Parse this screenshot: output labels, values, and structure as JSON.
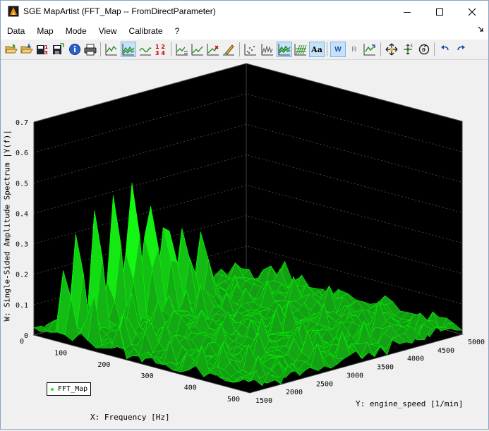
{
  "window": {
    "title": "SGE MapArtist (FFT_Map -- FromDirectParameter)",
    "controls": [
      "minimize",
      "maximize",
      "close"
    ]
  },
  "menu": {
    "items": [
      "Data",
      "Map",
      "Mode",
      "View",
      "Calibrate",
      "?"
    ],
    "overflow_icon": "chevron-down-right-icon"
  },
  "toolbar": {
    "buttons": [
      {
        "icon": "open-folder-icon"
      },
      {
        "icon": "open-folder-arrow-icon"
      },
      {
        "icon": "save-numbers-icon"
      },
      {
        "icon": "save-icon"
      },
      {
        "icon": "info-icon"
      },
      {
        "icon": "print-icon"
      },
      {
        "icon": "line-chart-icon"
      },
      {
        "icon": "surface-chart-icon",
        "active": true
      },
      {
        "icon": "wave-chart-icon"
      },
      {
        "icon": "table-numbers-icon",
        "text": "1 2\n3 4"
      },
      {
        "icon": "edit-chart-icon"
      },
      {
        "icon": "chart-cross-icon"
      },
      {
        "icon": "chart-pen-icon"
      },
      {
        "icon": "brush-icon"
      },
      {
        "icon": "scatter-icon"
      },
      {
        "icon": "spikes-icon"
      },
      {
        "icon": "surface-mode-icon",
        "active": true
      },
      {
        "icon": "grid-mode-icon"
      },
      {
        "icon": "font-icon",
        "text": "Aa",
        "active": true
      },
      {
        "icon": "w-axis-icon",
        "text": "W",
        "active": true
      },
      {
        "icon": "r-axis-icon",
        "text": "R"
      },
      {
        "icon": "refresh-chart-icon"
      },
      {
        "icon": "move-icon"
      },
      {
        "icon": "rotate-axes-icon"
      },
      {
        "icon": "reset-view-icon"
      },
      {
        "icon": "undo-icon"
      },
      {
        "icon": "redo-icon"
      }
    ]
  },
  "chart_data": {
    "type": "surface3d",
    "series_name": "FFT_Map",
    "color": "#00ff00",
    "background": "#000000",
    "xlabel": "X: Frequency [Hz]",
    "ylabel": "Y: engine_speed [1/min]",
    "zlabel": "W: Single-Sided Amplitude Spectrum |Y(f)|",
    "x_ticks": [
      "0",
      "100",
      "200",
      "300",
      "400",
      "500"
    ],
    "y_ticks": [
      "1500",
      "2000",
      "2500",
      "3000",
      "3500",
      "4000",
      "4500",
      "5000"
    ],
    "z_ticks": [
      "0",
      "0.1",
      "0.2",
      "0.3",
      "0.4",
      "0.5",
      "0.6",
      "0.7"
    ],
    "xlim": [
      0,
      500
    ],
    "ylim": [
      1500,
      5000
    ],
    "zlim": [
      0,
      0.7
    ],
    "noise_level": 0.05,
    "peaks": [
      {
        "x": 60,
        "y": 2700,
        "z": 0.72
      },
      {
        "x": 60,
        "y": 3000,
        "z": 0.66
      },
      {
        "x": 60,
        "y": 2400,
        "z": 0.61
      },
      {
        "x": 60,
        "y": 3300,
        "z": 0.57
      },
      {
        "x": 60,
        "y": 2100,
        "z": 0.52
      },
      {
        "x": 60,
        "y": 3600,
        "z": 0.45
      },
      {
        "x": 60,
        "y": 1800,
        "z": 0.42
      },
      {
        "x": 60,
        "y": 3900,
        "z": 0.35
      },
      {
        "x": 60,
        "y": 1600,
        "z": 0.28
      },
      {
        "x": 120,
        "y": 1600,
        "z": 0.2
      },
      {
        "x": 120,
        "y": 2200,
        "z": 0.18
      },
      {
        "x": 120,
        "y": 2800,
        "z": 0.16
      },
      {
        "x": 120,
        "y": 3500,
        "z": 0.14
      },
      {
        "x": 180,
        "y": 1700,
        "z": 0.13
      },
      {
        "x": 180,
        "y": 2500,
        "z": 0.11
      }
    ],
    "legend_location": "bottom-left"
  }
}
